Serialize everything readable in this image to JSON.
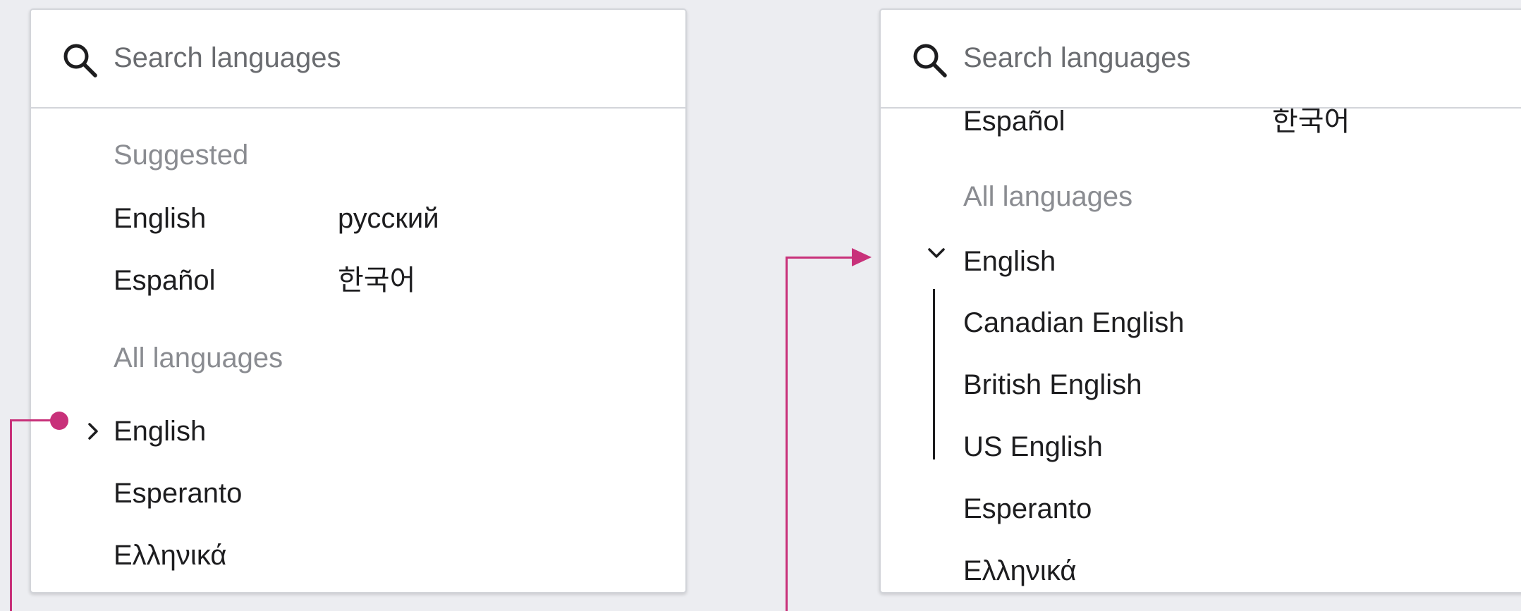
{
  "panel_collapsed": {
    "search": {
      "placeholder": "Search languages"
    },
    "suggested_heading": "Suggested",
    "suggested": [
      "English",
      "русский",
      "Español",
      "한국어"
    ],
    "all_heading": "All languages",
    "all_items": [
      "English",
      "Esperanto",
      "Ελληνικά"
    ]
  },
  "panel_expanded": {
    "search": {
      "placeholder": "Search languages"
    },
    "scrolled_suggested": [
      "Español",
      "한국어"
    ],
    "all_heading": "All languages",
    "expanded_item": "English",
    "sub_items": [
      "Canadian English",
      "British English",
      "US English"
    ],
    "other_items": [
      "Esperanto",
      "Ελληνικά"
    ]
  },
  "icons": {
    "search": "search-icon",
    "collapsed_chevron": "chevron-right-icon",
    "expanded_chevron": "chevron-down-icon"
  },
  "colors": {
    "accent": "#c8317a",
    "background": "#ecedf1",
    "heading_text": "#8a8c91",
    "body_text": "#1d1d1f"
  }
}
